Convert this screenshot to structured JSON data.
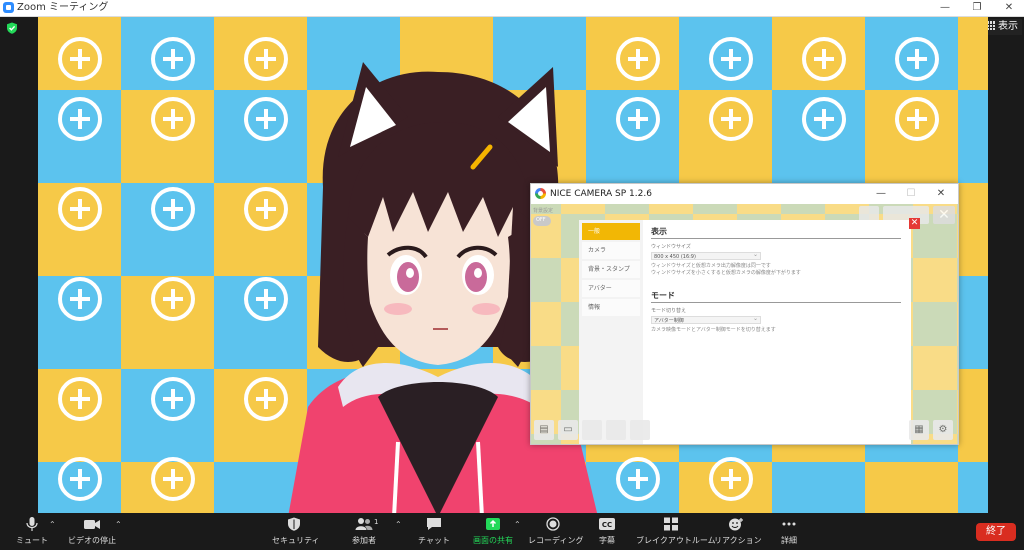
{
  "window": {
    "title": "Zoom ミーティング"
  },
  "topbar": {
    "view_label": "表示"
  },
  "nice_camera": {
    "title": "NICE CAMERA SP 1.2.6",
    "mini_label": "背景設定",
    "mini_toggle": "OFF",
    "sidebar": [
      {
        "label": "一般",
        "active": true
      },
      {
        "label": "カメラ",
        "active": false
      },
      {
        "label": "背景・スタンプ",
        "active": false
      },
      {
        "label": "アバター",
        "active": false
      },
      {
        "label": "情報",
        "active": false
      }
    ],
    "display_section": {
      "heading": "表示",
      "field_label": "ウィンドウサイズ",
      "field_value": "800 x 450 (16:9)",
      "note_line1": "ウィンドウサイズと仮想カメラ出力解像度は同一です",
      "note_line2": "ウィンドウサイズを小さくすると仮想カメラの解像度が下がります"
    },
    "mode_section": {
      "heading": "モード",
      "field_label": "モード切り替え",
      "field_value": "アバター制御",
      "note": "カメラ映像モードとアバター制御モードを切り替えます"
    }
  },
  "toolbar": {
    "mute": "ミュート",
    "video": "ビデオの停止",
    "security": "セキュリティ",
    "participants": "参加者",
    "participants_count": "1",
    "chat": "チャット",
    "share": "画面の共有",
    "record": "レコーディング",
    "captions": "字幕",
    "breakout": "ブレイクアウトルーム",
    "reactions": "リアクション",
    "more": "詳細",
    "end": "終了"
  },
  "colors": {
    "tile_yellow": "#f6c948",
    "tile_blue": "#5cc3ee",
    "share_green": "#23d959",
    "end_red": "#d92d20",
    "active_tab": "#f2b705"
  }
}
